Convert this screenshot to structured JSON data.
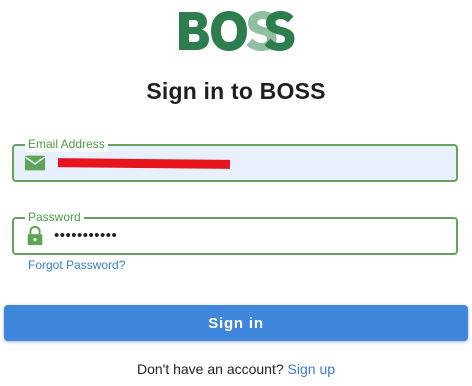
{
  "logo": {
    "text": "BOSS",
    "color": "#2e7d4f"
  },
  "page_title": "Sign in to BOSS",
  "email_field": {
    "label": "Email Address",
    "value": "",
    "value_redacted": true,
    "icon": "envelope-icon",
    "background": "#e8f0fe"
  },
  "password_field": {
    "label": "Password",
    "value_masked": "•••••••••••",
    "icon": "lock-icon"
  },
  "forgot_password": "Forgot Password?",
  "signin_button": "Sign in",
  "signup": {
    "prompt": "Don't have an account?",
    "link": "Sign up"
  },
  "colors": {
    "accent_green": "#63a35c",
    "button_blue": "#3f86dd",
    "link_blue": "#3a7ccf",
    "redaction_red": "#e8141c"
  }
}
